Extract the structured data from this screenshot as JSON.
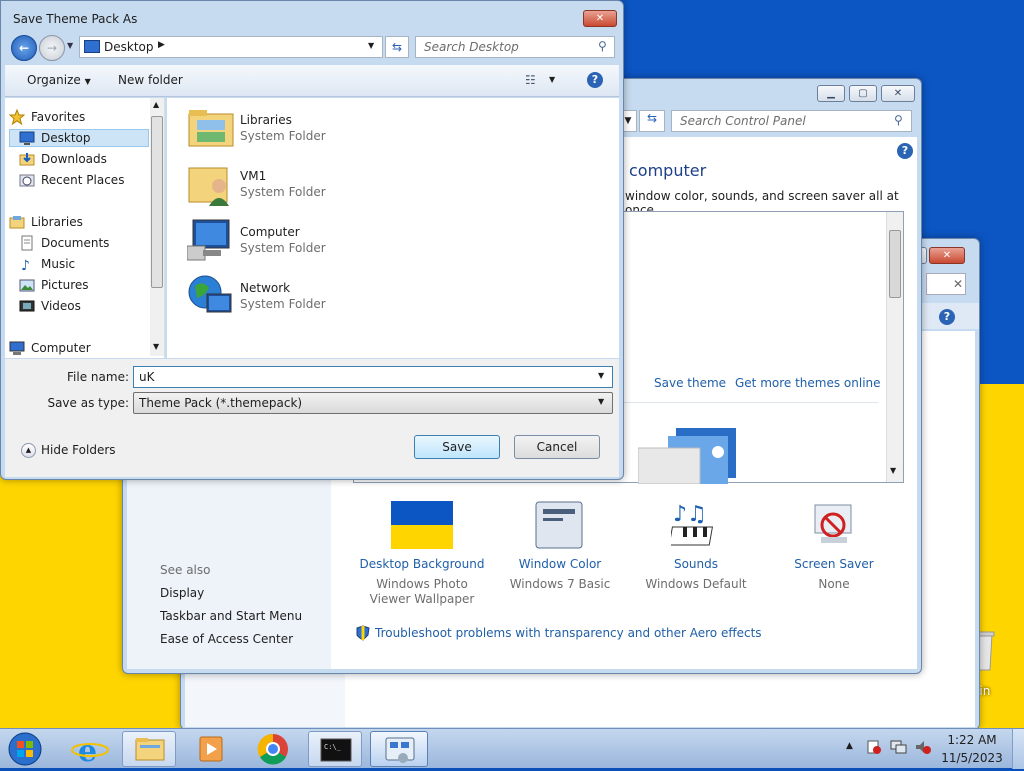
{
  "dialog": {
    "title": "Save Theme Pack As",
    "address": "Desktop",
    "search_placeholder": "Search Desktop",
    "organize": "Organize",
    "new_folder": "New folder",
    "nav": [
      {
        "label": "Favorites",
        "icon": "star-icon"
      },
      {
        "label": "Desktop",
        "icon": "desktop-icon"
      },
      {
        "label": "Downloads",
        "icon": "downloads-icon"
      },
      {
        "label": "Recent Places",
        "icon": "recent-places-icon"
      },
      {
        "label": "Libraries",
        "icon": "libraries-icon"
      },
      {
        "label": "Documents",
        "icon": "documents-icon"
      },
      {
        "label": "Music",
        "icon": "music-icon"
      },
      {
        "label": "Pictures",
        "icon": "pictures-icon"
      },
      {
        "label": "Videos",
        "icon": "videos-icon"
      },
      {
        "label": "Computer",
        "icon": "computer-icon"
      }
    ],
    "items": [
      {
        "name": "Libraries",
        "type": "System Folder"
      },
      {
        "name": "VM1",
        "type": "System Folder"
      },
      {
        "name": "Computer",
        "type": "System Folder"
      },
      {
        "name": "Network",
        "type": "System Folder"
      }
    ],
    "file_name_label": "File name:",
    "file_name_value": "uK",
    "save_type_label": "Save as type:",
    "save_type_value": "Theme Pack (*.themepack)",
    "hide_folders": "Hide Folders",
    "save": "Save",
    "cancel": "Cancel"
  },
  "control_panel": {
    "search_placeholder": "Search Control Panel",
    "heading": "computer",
    "subtext": "window color, sounds, and screen saver all at once.",
    "save_theme": "Save theme",
    "more_themes": "Get more themes online",
    "see_also": "See also",
    "links": [
      "Display",
      "Taskbar and Start Menu",
      "Ease of Access Center"
    ],
    "settings": [
      {
        "title": "Desktop Background",
        "sub": "Windows Photo Viewer Wallpaper"
      },
      {
        "title": "Window Color",
        "sub": "Windows 7 Basic"
      },
      {
        "title": "Sounds",
        "sub": "Windows Default"
      },
      {
        "title": "Screen Saver",
        "sub": "None"
      }
    ],
    "troubleshoot": "Troubleshoot problems with transparency and other Aero effects"
  },
  "desktop": {
    "recycle_bin": "e Bin"
  },
  "taskbar": {
    "time": "1:22 AM",
    "date": "11/5/2023"
  }
}
